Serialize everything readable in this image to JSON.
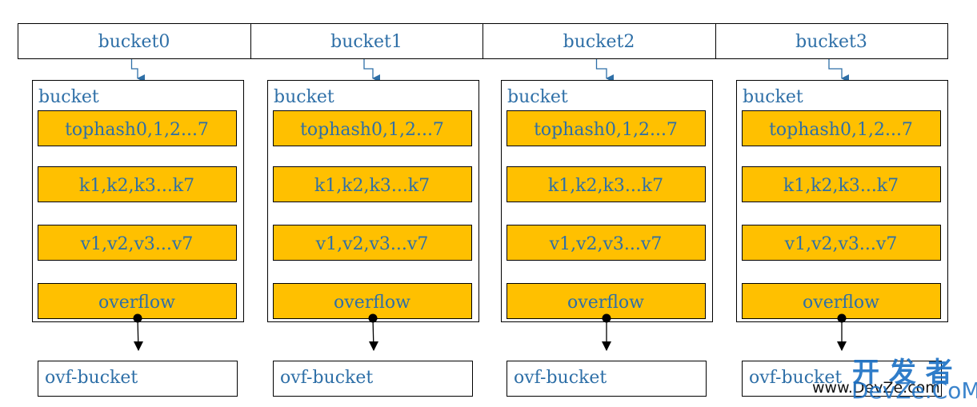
{
  "colors": {
    "text": "#2e6fa7",
    "fill": "#ffc000",
    "stroke": "#000000",
    "arrow": "#2e6fa7"
  },
  "array": [
    {
      "label": "bucket0"
    },
    {
      "label": "bucket1"
    },
    {
      "label": "bucket2"
    },
    {
      "label": "bucket3"
    }
  ],
  "bucket_title": "bucket",
  "fields": [
    "tophash0,1,2...7",
    "k1,k2,k3...k7",
    "v1,v2,v3...v7",
    "overflow"
  ],
  "overflow_bucket": "ovf-bucket",
  "watermark": {
    "cn": "开 发 者",
    "brand": "DevZe.CoM",
    "url": "www.DevZe.com"
  }
}
